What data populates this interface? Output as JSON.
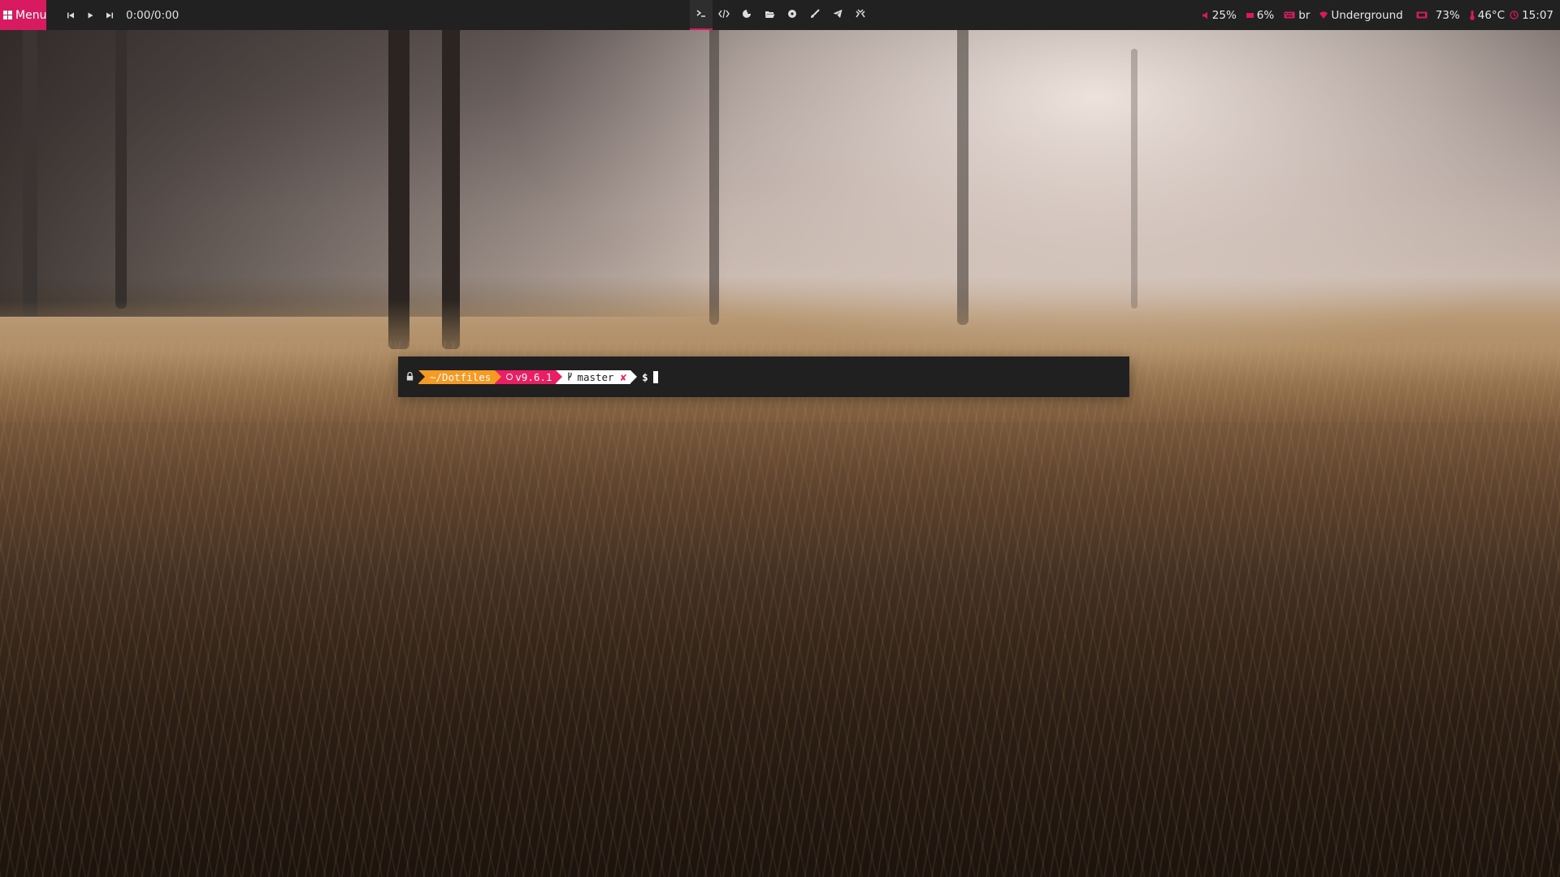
{
  "panel": {
    "menu_label": "Menu",
    "media": {
      "prev_icon": "skip-previous-icon",
      "play_icon": "play-icon",
      "next_icon": "skip-next-icon",
      "time": "0:00/0:00"
    },
    "launchers": [
      {
        "name": "terminal",
        "icon": "terminal-icon",
        "active": true
      },
      {
        "name": "code-editor",
        "icon": "code-icon"
      },
      {
        "name": "browser",
        "icon": "firefox-icon"
      },
      {
        "name": "files",
        "icon": "folder-open-icon"
      },
      {
        "name": "music",
        "icon": "record-icon"
      },
      {
        "name": "paint",
        "icon": "brush-icon"
      },
      {
        "name": "telegram",
        "icon": "send-icon"
      },
      {
        "name": "game",
        "icon": "gamepad-icon"
      }
    ],
    "status": {
      "volume": "25%",
      "battery": "6%",
      "keyboard_layout": "br",
      "network": "Underground",
      "memory": "73%",
      "temperature": "46°C",
      "clock": "15:07"
    },
    "colors": {
      "accent": "#d81b60",
      "panel_bg": "#212121"
    }
  },
  "terminal": {
    "path": "~/Dotfiles",
    "node_version": "v9.6.1",
    "git_branch": "master",
    "git_dirty": "✘",
    "prompt_symbol": "$",
    "colors": {
      "path_bg": "#f59a23",
      "node_bg": "#e91e63",
      "git_bg": "#ffffff",
      "terminal_bg": "#202020"
    }
  }
}
